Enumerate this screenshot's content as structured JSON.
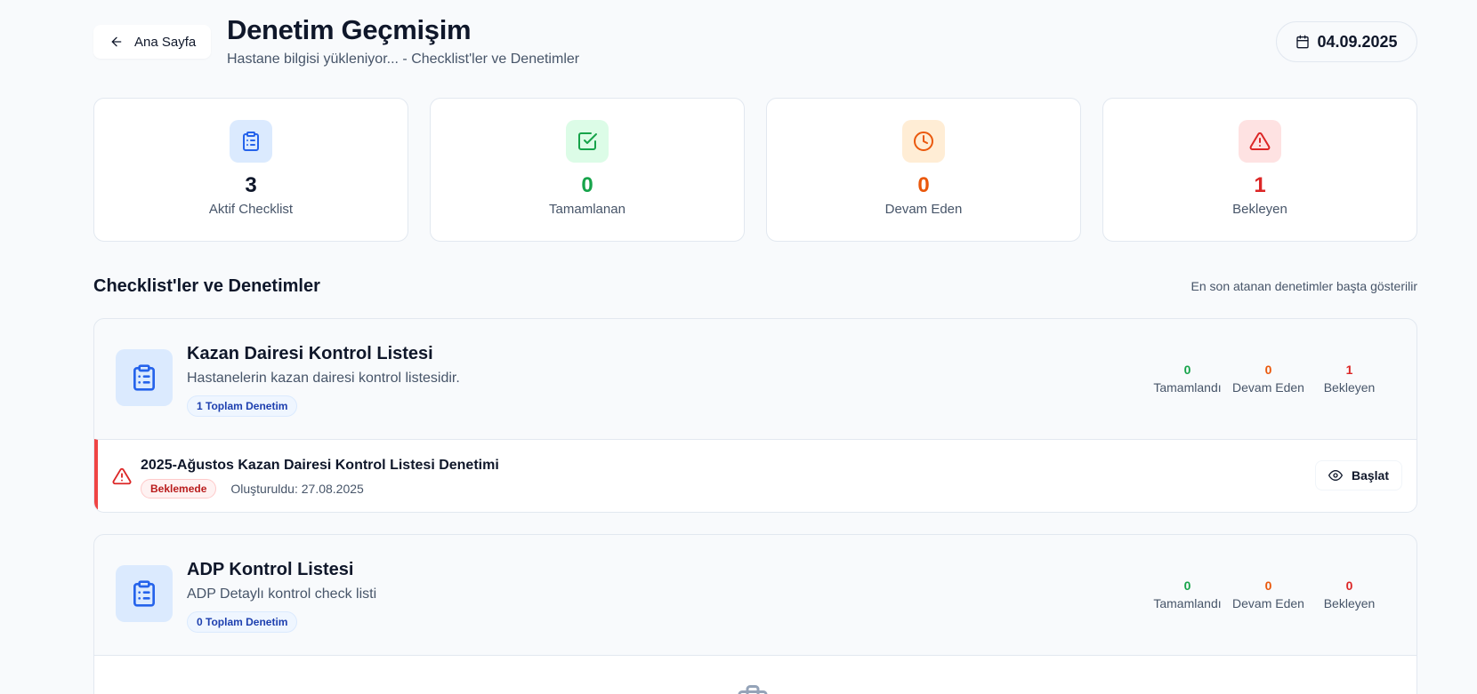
{
  "header": {
    "back_label": "Ana Sayfa",
    "title": "Denetim Geçmişim",
    "subtitle": "Hastane bilgisi yükleniyor... - Checklist'ler ve Denetimler",
    "date": "04.09.2025"
  },
  "stats": [
    {
      "value": "3",
      "label": "Aktif Checklist",
      "color": "#0f172a",
      "icon": "clipboard-icon",
      "icon_bg": "#dbeafe",
      "icon_color": "#2563eb"
    },
    {
      "value": "0",
      "label": "Tamamlanan",
      "color": "#16a34a",
      "icon": "check-square-icon",
      "icon_bg": "#dcfce7",
      "icon_color": "#16a34a"
    },
    {
      "value": "0",
      "label": "Devam Eden",
      "color": "#ea580c",
      "icon": "clock-icon",
      "icon_bg": "#ffedd5",
      "icon_color": "#ea580c"
    },
    {
      "value": "1",
      "label": "Bekleyen",
      "color": "#dc2626",
      "icon": "alert-triangle-icon",
      "icon_bg": "#fee2e2",
      "icon_color": "#dc2626"
    }
  ],
  "section": {
    "title": "Checklist'ler ve Denetimler",
    "note": "En son atanan denetimler başta gösterilir"
  },
  "checklists": [
    {
      "title": "Kazan Dairesi Kontrol Listesi",
      "description": "Hastanelerin kazan dairesi kontrol listesidir.",
      "badge": "1 Toplam Denetim",
      "counts": [
        {
          "value": "0",
          "label": "Tamamlandı",
          "color": "#16a34a"
        },
        {
          "value": "0",
          "label": "Devam Eden",
          "color": "#ea580c"
        },
        {
          "value": "1",
          "label": "Bekleyen",
          "color": "#dc2626"
        }
      ],
      "audits": [
        {
          "title": "2025-Ağustos Kazan Dairesi Kontrol Listesi Denetimi",
          "status": "Beklemede",
          "created": "Oluşturuldu: 27.08.2025",
          "action": "Başlat"
        }
      ]
    },
    {
      "title": "ADP Kontrol Listesi",
      "description": "ADP Detaylı kontrol check listi",
      "badge": "0 Toplam Denetim",
      "counts": [
        {
          "value": "0",
          "label": "Tamamlandı",
          "color": "#16a34a"
        },
        {
          "value": "0",
          "label": "Devam Eden",
          "color": "#ea580c"
        },
        {
          "value": "0",
          "label": "Bekleyen",
          "color": "#dc2626"
        }
      ],
      "audits": []
    }
  ]
}
